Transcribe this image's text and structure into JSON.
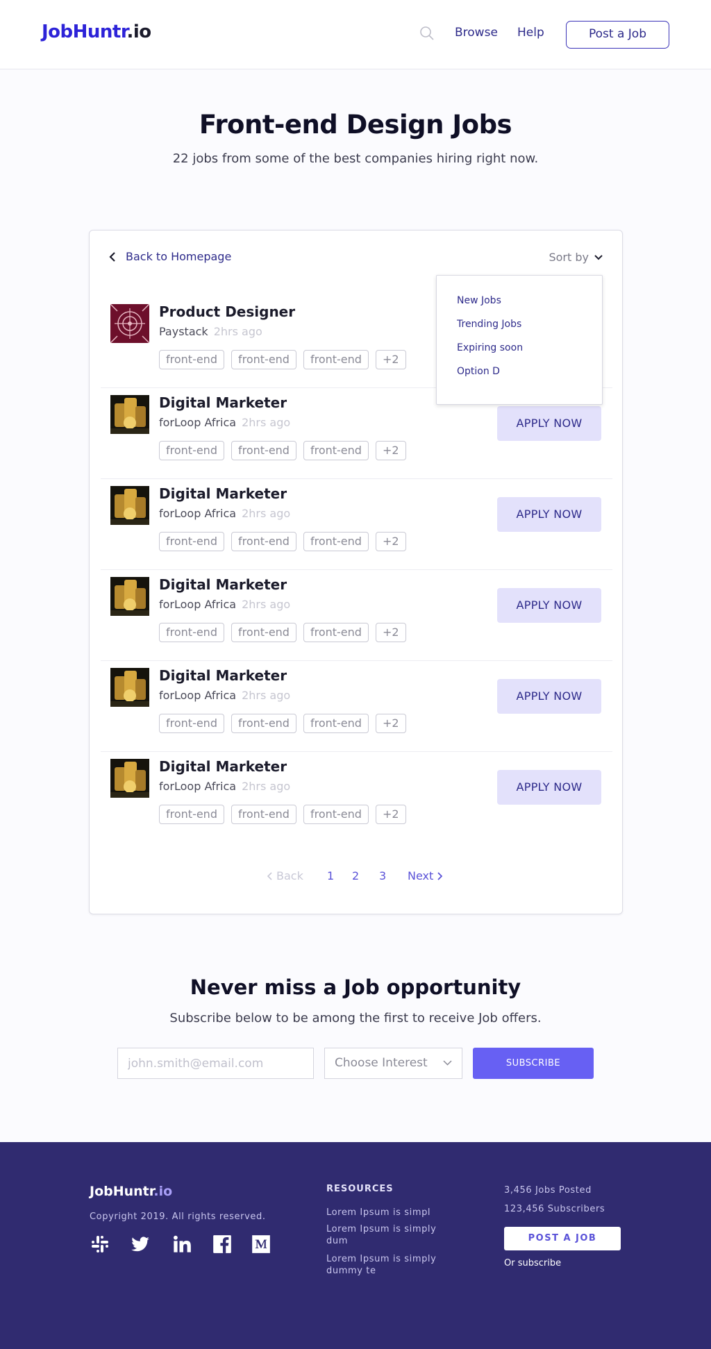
{
  "header": {
    "logo_main": "JobHuntr",
    "logo_suffix": ".io",
    "nav": {
      "browse": "Browse",
      "help": "Help",
      "post_job": "Post a Job"
    },
    "icons": {
      "search": "search-icon"
    }
  },
  "hero": {
    "title": "Front-end Design Jobs",
    "subtitle": "22 jobs from some of the best companies hiring right now."
  },
  "listing": {
    "back_label": "Back to Homepage",
    "sort_label": "Sort by",
    "sort_options": [
      "New Jobs",
      "Trending Jobs",
      "Expiring soon",
      "Option D"
    ],
    "jobs": [
      {
        "title": "Product Designer",
        "company": "Paystack",
        "time": "2hrs ago",
        "tags": [
          "front-end",
          "front-end",
          "front-end",
          "+2"
        ],
        "apply": "",
        "logo": "paystack-logo"
      },
      {
        "title": "Digital Marketer",
        "company": "forLoop Africa",
        "time": "2hrs ago",
        "tags": [
          "front-end",
          "front-end",
          "front-end",
          "+2"
        ],
        "apply": "APPLY NOW",
        "logo": "forloop-logo"
      },
      {
        "title": "Digital Marketer",
        "company": "forLoop Africa",
        "time": "2hrs ago",
        "tags": [
          "front-end",
          "front-end",
          "front-end",
          "+2"
        ],
        "apply": "APPLY NOW",
        "logo": "forloop-logo"
      },
      {
        "title": "Digital Marketer",
        "company": "forLoop Africa",
        "time": "2hrs ago",
        "tags": [
          "front-end",
          "front-end",
          "front-end",
          "+2"
        ],
        "apply": "APPLY NOW",
        "logo": "forloop-logo"
      },
      {
        "title": "Digital Marketer",
        "company": "forLoop Africa",
        "time": "2hrs ago",
        "tags": [
          "front-end",
          "front-end",
          "front-end",
          "+2"
        ],
        "apply": "APPLY NOW",
        "logo": "forloop-logo"
      },
      {
        "title": "Digital Marketer",
        "company": "forLoop Africa",
        "time": "2hrs ago",
        "tags": [
          "front-end",
          "front-end",
          "front-end",
          "+2"
        ],
        "apply": "APPLY NOW",
        "logo": "forloop-logo"
      }
    ],
    "pagination": {
      "back": "Back",
      "pages": [
        "1",
        "2",
        "3"
      ],
      "next": "Next"
    }
  },
  "subscribe": {
    "title": "Never miss a Job opportunity",
    "subtitle": "Subscribe below to be among the first to receive Job offers.",
    "email_placeholder": "john.smith@email.com",
    "interest_placeholder": "Choose Interest",
    "button": "SUBSCRIBE"
  },
  "footer": {
    "logo_main": "JobHuntr",
    "logo_suffix": ".io",
    "copyright": "Copyright 2019. All rights reserved.",
    "social_icons": [
      "slack-icon",
      "twitter-icon",
      "linkedin-icon",
      "facebook-icon",
      "medium-icon"
    ],
    "resources_title": "RESOURCES",
    "resources": [
      "Lorem Ipsum is simpl",
      "Lorem Ipsum is simply dum",
      "Lorem Ipsum is simply dummy te"
    ],
    "stats": [
      "3,456 Jobs Posted",
      "123,456 Subscribers"
    ],
    "post_job": "POST A JOB",
    "or_subscribe": "Or subscribe"
  },
  "colors": {
    "brand": "#2d23d8",
    "accent": "#6760f3",
    "apply_bg": "#e3e1fb",
    "footer_bg": "#302b70"
  }
}
